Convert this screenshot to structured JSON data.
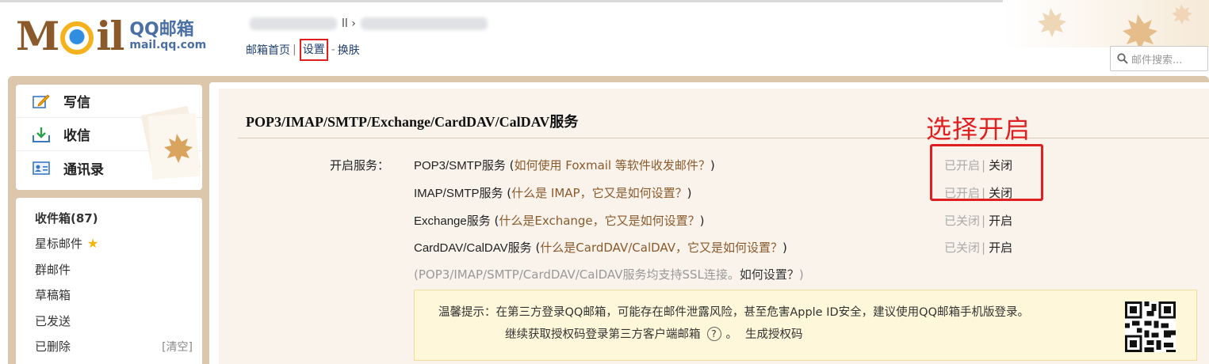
{
  "header": {
    "logo_mail": "MOil",
    "logo_brand": "QQ邮箱",
    "logo_url": "mail.qq.com",
    "user_separator": "ll ›",
    "nav": {
      "home": "邮箱首页",
      "settings": "设置",
      "sep_dash": "-",
      "skin": "换肤"
    },
    "search_placeholder": "邮件搜索..."
  },
  "sidebar": {
    "quick": [
      {
        "label": "写信",
        "icon": "compose-icon"
      },
      {
        "label": "收信",
        "icon": "inbox-download-icon"
      },
      {
        "label": "通讯录",
        "icon": "contacts-icon"
      }
    ],
    "folders": [
      {
        "label": "收件箱(87)",
        "bold": true
      },
      {
        "label": "星标邮件",
        "star": "★"
      },
      {
        "label": "群邮件"
      },
      {
        "label": "草稿箱"
      },
      {
        "label": "已发送"
      },
      {
        "label": "已删除",
        "extra": "[清空]"
      }
    ]
  },
  "main": {
    "section_title": "POP3/IMAP/SMTP/Exchange/CardDAV/CalDAV服务",
    "enable_label": "开启服务：",
    "services": [
      {
        "name": "POP3/SMTP服务",
        "help": "如何使用 Foxmail 等软件收发邮件？",
        "state": "已开启",
        "action": "关闭"
      },
      {
        "name": "IMAP/SMTP服务",
        "help": "什么是 IMAP，它又是如何设置？",
        "state": "已开启",
        "action": "关闭"
      },
      {
        "name": "Exchange服务",
        "help": "什么是Exchange，它又是如何设置？",
        "state": "已关闭",
        "action": "开启"
      },
      {
        "name": "CardDAV/CalDAV服务",
        "help": "什么是CardDAV/CalDAV，它又是如何设置？",
        "state": "已关闭",
        "action": "开启"
      }
    ],
    "ssl_note": "(POP3/IMAP/SMTP/CardDAV/CalDAV服务均支持SSL连接。",
    "ssl_how": "如何设置？",
    "ssl_close": ")",
    "tip": {
      "line1": "温馨提示：在第三方登录QQ邮箱，可能存在邮件泄露风险，甚至危害Apple ID安全，建议使用QQ邮箱手机版登录。",
      "line2": "继续获取授权码登录第三方客户端邮箱",
      "help_glyph": "?",
      "period": "。",
      "generate": "生成授权码"
    }
  },
  "annotation": {
    "label": "选择开启",
    "color": "#e02020"
  }
}
